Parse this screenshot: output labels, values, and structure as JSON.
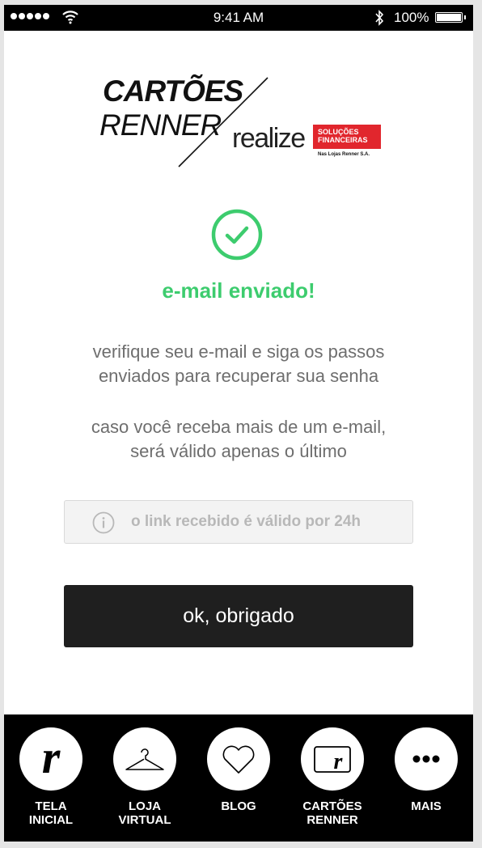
{
  "status_bar": {
    "time": "9:41 AM",
    "battery_percent": "100%",
    "battery_level": 1.0,
    "signal_bars": 5
  },
  "logo": {
    "line1": "CARTÕES",
    "line2": "RENNER",
    "brand": "realize",
    "badge_line1": "SOLUÇÕES",
    "badge_line2": "FINANCEIRAS",
    "sub": "Nas Lojas Renner S.A.",
    "badge_color": "#e1262d"
  },
  "content": {
    "title": "e-mail enviado!",
    "message1_line1": "verifique seu e-mail e siga os passos",
    "message1_line2": "enviados para recuperar sua senha",
    "message2_line1": "caso você receba mais de um e-mail,",
    "message2_line2": "será válido apenas o último",
    "info_text": "o link recebido é válido por 24h",
    "button_label": "ok, obrigado",
    "accent_color": "#3dcc6e"
  },
  "tabs": [
    {
      "line1": "TELA",
      "line2": "INICIAL",
      "icon": "renner-r-icon"
    },
    {
      "line1": "LOJA",
      "line2": "VIRTUAL",
      "icon": "hanger-icon"
    },
    {
      "line1": "BLOG",
      "line2": "",
      "icon": "heart-icon"
    },
    {
      "line1": "CARTÕES",
      "line2": "RENNER",
      "icon": "card-icon"
    },
    {
      "line1": "MAIS",
      "line2": "",
      "icon": "more-dots-icon"
    }
  ]
}
